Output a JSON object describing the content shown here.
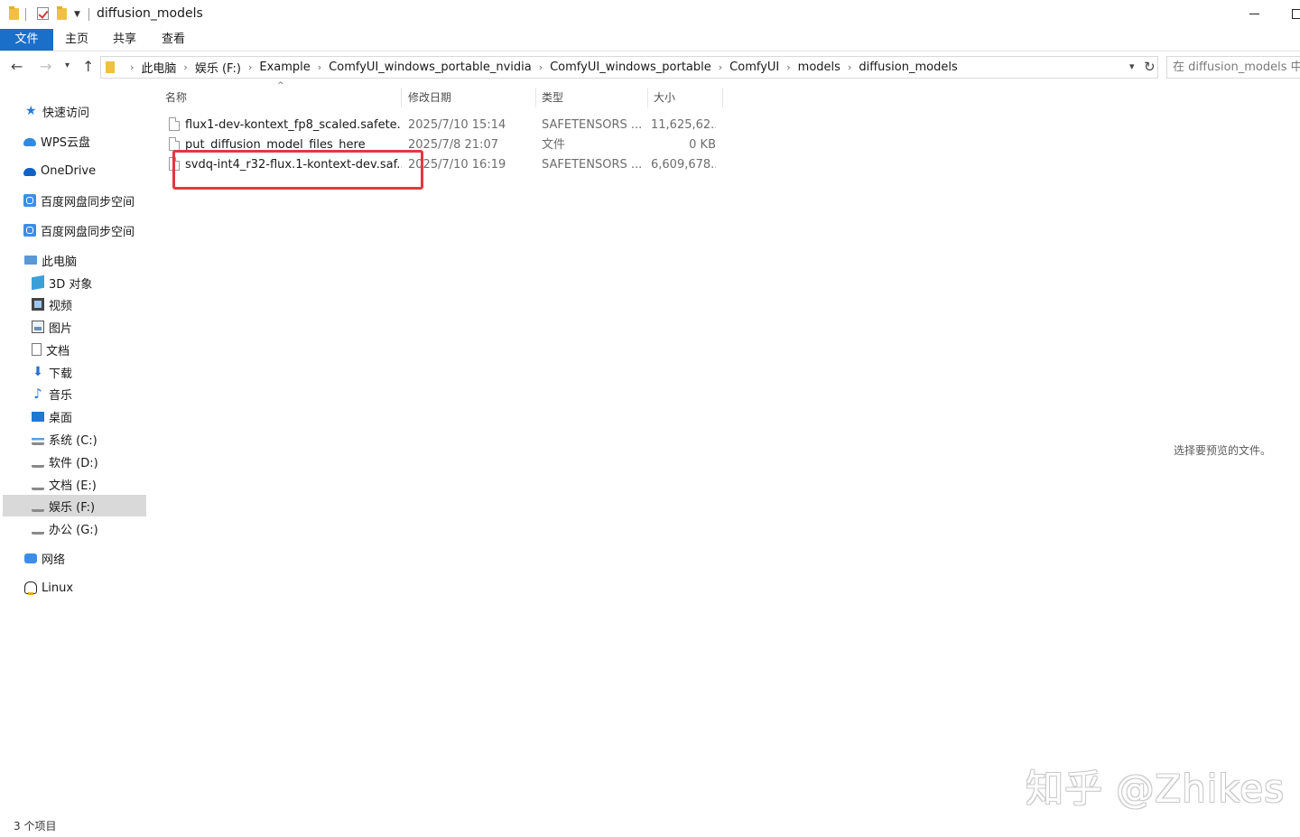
{
  "window": {
    "title": "diffusion_models"
  },
  "ribbon": {
    "tabs": [
      "文件",
      "主页",
      "共享",
      "查看"
    ]
  },
  "address": {
    "crumbs": [
      "此电脑",
      "娱乐 (F:)",
      "Example",
      "ComfyUI_windows_portable_nvidia",
      "ComfyUI_windows_portable",
      "ComfyUI",
      "models",
      "diffusion_models"
    ],
    "search_placeholder": "在 diffusion_models 中搜索"
  },
  "sidebar": {
    "quick_access": "快速访问",
    "wps": "WPS云盘",
    "onedrive": "OneDrive",
    "baidu1": "百度网盘同步空间",
    "baidu2": "百度网盘同步空间",
    "this_pc": "此电脑",
    "objects3d": "3D 对象",
    "videos": "视频",
    "pictures": "图片",
    "documents": "文档",
    "downloads": "下载",
    "music": "音乐",
    "desktop": "桌面",
    "drive_c": "系统 (C:)",
    "drive_d": "软件 (D:)",
    "drive_e": "文档 (E:)",
    "drive_f": "娱乐 (F:)",
    "drive_g": "办公 (G:)",
    "network": "网络",
    "linux": "Linux"
  },
  "columns": {
    "name": "名称",
    "date": "修改日期",
    "type": "类型",
    "size": "大小"
  },
  "files": [
    {
      "name": "flux1-dev-kontext_fp8_scaled.safete...",
      "date": "2025/7/10 15:14",
      "type": "SAFETENSORS ...",
      "size": "11,625,62..."
    },
    {
      "name": "put_diffusion_model_files_here",
      "date": "2025/7/8 21:07",
      "type": "文件",
      "size": "0 KB"
    },
    {
      "name": "svdq-int4_r32-flux.1-kontext-dev.saf...",
      "date": "2025/7/10 16:19",
      "type": "SAFETENSORS ...",
      "size": "6,609,678..."
    }
  ],
  "preview_message": "选择要预览的文件。",
  "status": "3 个项目",
  "watermark": "知乎 @Zhikes",
  "colors": {
    "accent": "#1a6fc9",
    "highlight": "#e0393f",
    "selected": "#d9d9d9"
  }
}
